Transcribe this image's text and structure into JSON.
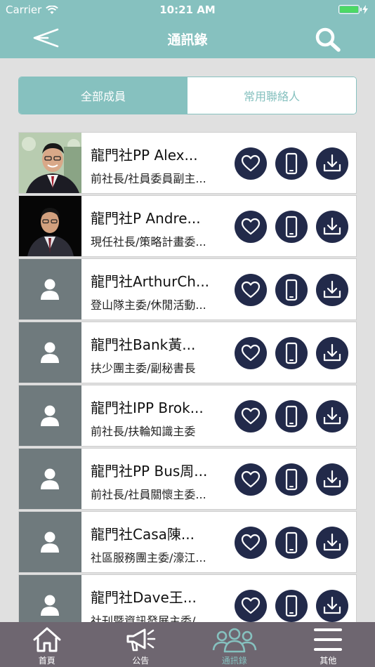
{
  "status_bar": {
    "carrier": "Carrier",
    "time": "10:21 AM"
  },
  "header": {
    "title": "通訊錄"
  },
  "segments": {
    "all_members": "全部成員",
    "favorites": "常用聯絡人"
  },
  "contacts": [
    {
      "name": "龍門社PP Alex...",
      "role": "前社長/社員委員副主...",
      "has_photo": true
    },
    {
      "name": "龍門社P Andre...",
      "role": "現任社長/策略計畫委...",
      "has_photo": true
    },
    {
      "name": "龍門社ArthurCh...",
      "role": "登山隊主委/休閒活動...",
      "has_photo": false
    },
    {
      "name": "龍門社Bank黃...",
      "role": "扶少團主委/副秘書長",
      "has_photo": false
    },
    {
      "name": "龍門社IPP Brok...",
      "role": "前社長/扶輪知識主委",
      "has_photo": false
    },
    {
      "name": "龍門社PP Bus周...",
      "role": "前社長/社員關懷主委...",
      "has_photo": false
    },
    {
      "name": "龍門社Casa陳...",
      "role": "社區服務團主委/濠江...",
      "has_photo": false
    },
    {
      "name": "龍門社Dave王...",
      "role": "社刊暨資訊發展主委/...",
      "has_photo": false
    }
  ],
  "tabs": [
    {
      "label": "首頁",
      "icon": "home-icon"
    },
    {
      "label": "公告",
      "icon": "megaphone-icon"
    },
    {
      "label": "通訊錄",
      "icon": "people-icon"
    },
    {
      "label": "其他",
      "icon": "menu-icon"
    }
  ],
  "colors": {
    "accent": "#86c1bf",
    "button": "#222a4a",
    "tab_bar": "#6e6670",
    "placeholder": "#6f7a7d"
  }
}
